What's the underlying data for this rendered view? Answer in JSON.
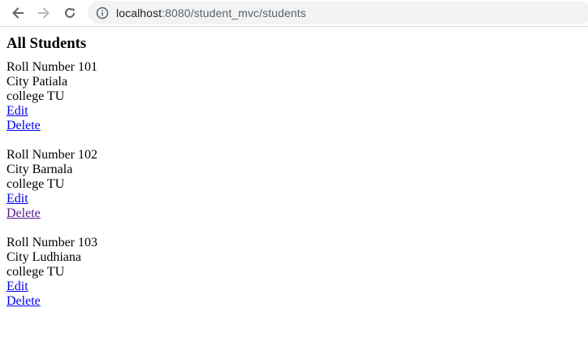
{
  "browser": {
    "url_host": "localhost",
    "url_path": ":8080/student_mvc/students",
    "back_icon": "arrow-left-icon",
    "forward_icon": "arrow-right-icon",
    "reload_icon": "reload-icon",
    "site_info_icon": "info-icon"
  },
  "page": {
    "title": "All Students",
    "students": [
      {
        "roll_label": "Roll Number",
        "roll": "101",
        "city_label": "City",
        "city": "Patiala",
        "college_label": "college",
        "college": "TU",
        "edit": "Edit",
        "delete": "Delete"
      },
      {
        "roll_label": "Roll Number",
        "roll": "102",
        "city_label": "City",
        "city": "Barnala",
        "college_label": "college",
        "college": "TU",
        "edit": "Edit",
        "delete": "Delete"
      },
      {
        "roll_label": "Roll Number",
        "roll": "103",
        "city_label": "City",
        "city": "Ludhiana",
        "college_label": "college",
        "college": "TU",
        "edit": "Edit",
        "delete": "Delete"
      }
    ]
  },
  "colors": {
    "link": "#0000ee",
    "visited_link": "#551a8b",
    "omnibox_bg": "#f1f3f4"
  }
}
